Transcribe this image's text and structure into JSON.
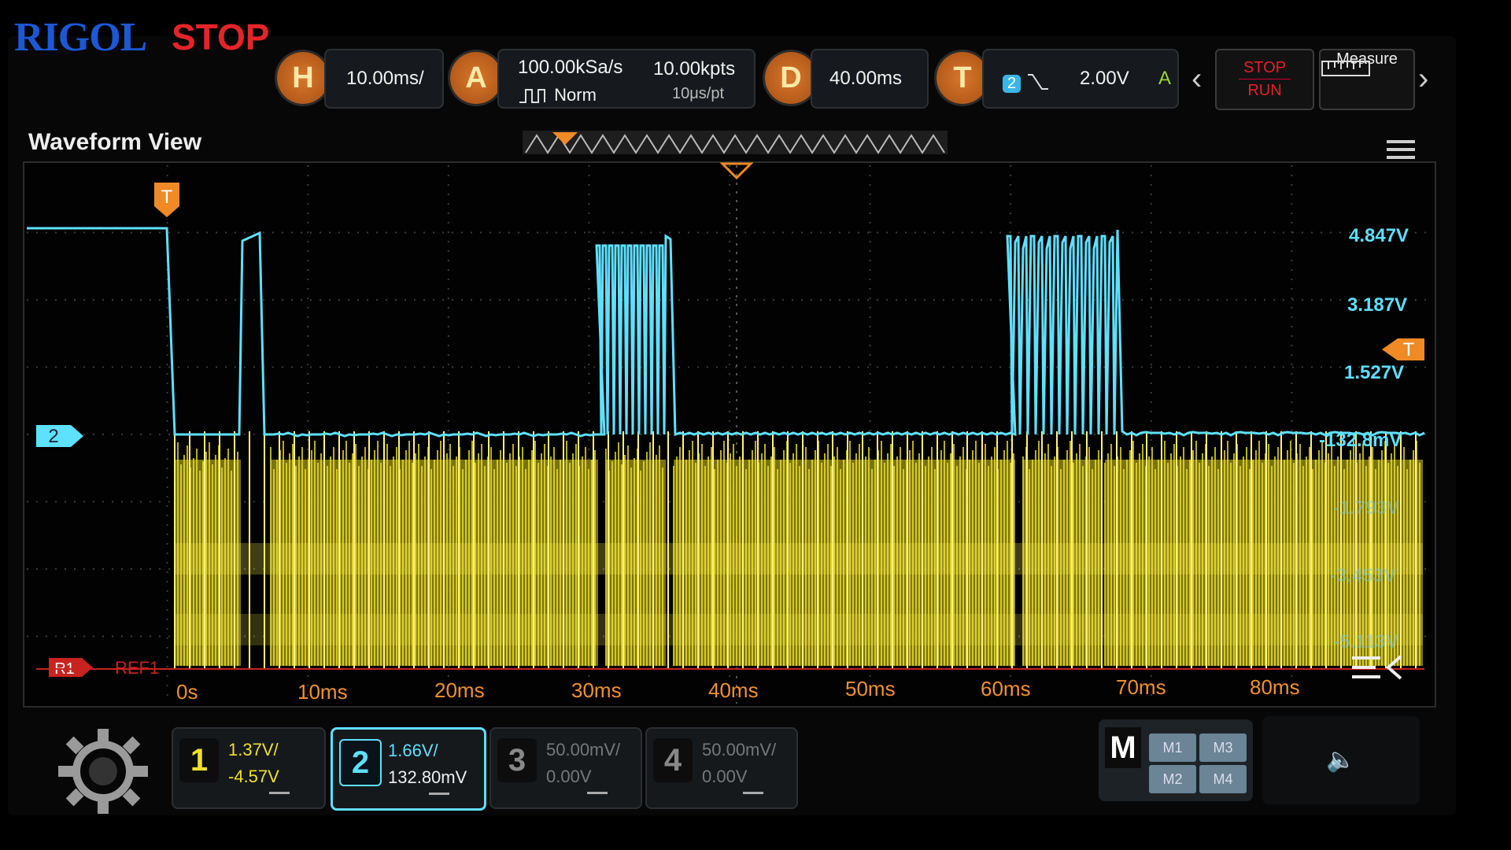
{
  "header": {
    "brand": "RIGOL",
    "run_state": "STOP",
    "horizontal": {
      "button": "H",
      "scale": "10.00ms/"
    },
    "acquire": {
      "button": "A",
      "sample_rate": "100.00kSa/s",
      "mode": "Norm",
      "memory_depth": "10.00kpts",
      "resolution": "10μs/pt"
    },
    "delay": {
      "button": "D",
      "value": "40.00ms"
    },
    "trigger": {
      "button": "T",
      "source": "2",
      "level": "2.00V",
      "sweep": "A"
    },
    "stop_run": {
      "stop": "STOP",
      "run": "RUN"
    },
    "measure_label": "Measure"
  },
  "waveform": {
    "title": "Waveform View",
    "trigger_marker": "T",
    "ch2_marker": "2",
    "ref_marker": "R1",
    "ref_label": "REF1",
    "voltage_labels": [
      "4.847V",
      "3.187V",
      "1.527V",
      "-132.8mV",
      "-1.793V",
      "-3.453V",
      "-5.113V"
    ],
    "time_labels": [
      "0s",
      "10ms",
      "20ms",
      "30ms",
      "40ms",
      "50ms",
      "60ms",
      "70ms",
      "80ms"
    ]
  },
  "channels": [
    {
      "number": "1",
      "scale": "1.37V/",
      "offset": "-4.57V",
      "color": "#f0e02a",
      "active": false
    },
    {
      "number": "2",
      "scale": "1.66V/",
      "offset": "132.80mV",
      "color": "#5ee0ff",
      "active": true
    },
    {
      "number": "3",
      "scale": "50.00mV/",
      "offset": "0.00V",
      "color": "#7c7c7c",
      "active": false
    },
    {
      "number": "4",
      "scale": "50.00mV/",
      "offset": "0.00V",
      "color": "#7c7c7c",
      "active": false
    }
  ],
  "math": {
    "label": "M",
    "buttons": [
      "M1",
      "M3",
      "M2",
      "M4"
    ]
  },
  "colors": {
    "ch1": "#f0e02a",
    "ch2": "#5ee0ff",
    "trigger": "#f08a24",
    "stop": "#e5242a",
    "brand": "#1b58d6"
  }
}
